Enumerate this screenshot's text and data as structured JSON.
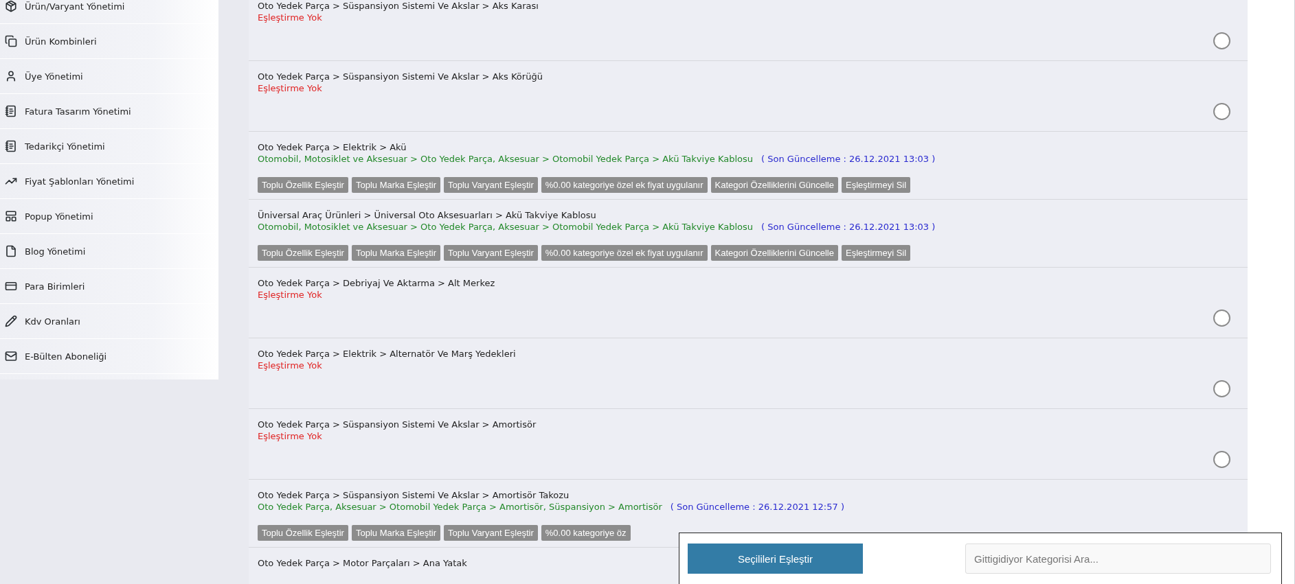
{
  "sidebar": {
    "items": [
      {
        "label": "Ürün/Varyant Yönetimi"
      },
      {
        "label": "Ürün Kombinleri"
      },
      {
        "label": "Üye Yönetimi"
      },
      {
        "label": "Fatura Tasarım Yönetimi"
      },
      {
        "label": "Tedarikçi Yönetimi"
      },
      {
        "label": "Fiyat Şablonları Yönetimi"
      },
      {
        "label": "Popup Yönetimi"
      },
      {
        "label": "Blog Yönetimi"
      },
      {
        "label": "Para Birimleri"
      },
      {
        "label": "Kdv Oranları"
      },
      {
        "label": "E-Bülten Aboneliği"
      }
    ]
  },
  "categories": [
    {
      "kind": "unmapped",
      "path": "Oto Yedek Parça > Süspansiyon Sistemi Ve Akslar > Aks Karası",
      "status": "Eşleştirme Yok",
      "selected": false
    },
    {
      "kind": "unmapped",
      "path": "Oto Yedek Parça > Süspansiyon Sistemi Ve Akslar > Aks Körüğü",
      "status": "Eşleştirme Yok",
      "selected": false
    },
    {
      "kind": "mapped",
      "path": "Oto Yedek Parça > Elektrik > Akü",
      "mapping": "Otomobil, Motosiklet ve Aksesuar > Oto Yedek Parça, Aksesuar > Otomobil Yedek Parça > Akü Takviye Kablosu",
      "updated": "( Son Güncelleme : 26.12.2021 13:03 )",
      "actions": [
        "Toplu Özellik Eşleştir",
        "Toplu Marka Eşleştir",
        "Toplu Varyant Eşleştir",
        "%0.00 kategoriye özel ek fiyat uygulanır",
        "Kategori Özelliklerini Güncelle",
        "Eşleştirmeyi Sil"
      ]
    },
    {
      "kind": "mapped",
      "path": "Üniversal Araç Ürünleri > Üniversal Oto Aksesuarları > Akü Takviye Kablosu",
      "mapping": "Otomobil, Motosiklet ve Aksesuar > Oto Yedek Parça, Aksesuar > Otomobil Yedek Parça > Akü Takviye Kablosu",
      "updated": "( Son Güncelleme : 26.12.2021 13:03 )",
      "actions": [
        "Toplu Özellik Eşleştir",
        "Toplu Marka Eşleştir",
        "Toplu Varyant Eşleştir",
        "%0.00 kategoriye özel ek fiyat uygulanır",
        "Kategori Özelliklerini Güncelle",
        "Eşleştirmeyi Sil"
      ]
    },
    {
      "kind": "unmapped",
      "path": "Oto Yedek Parça > Debriyaj Ve Aktarma > Alt Merkez",
      "status": "Eşleştirme Yok",
      "selected": false
    },
    {
      "kind": "unmapped",
      "path": "Oto Yedek Parça > Elektrik > Alternatör Ve Marş Yedekleri",
      "status": "Eşleştirme Yok",
      "selected": false
    },
    {
      "kind": "unmapped",
      "path": "Oto Yedek Parça > Süspansiyon Sistemi Ve Akslar > Amortisör",
      "status": "Eşleştirme Yok",
      "selected": false
    },
    {
      "kind": "mapped",
      "path": "Oto Yedek Parça > Süspansiyon Sistemi Ve Akslar > Amortisör Takozu",
      "mapping": "Oto Yedek Parça, Aksesuar > Otomobil Yedek Parça > Amortisör, Süspansiyon > Amortisör",
      "updated": "( Son Güncelleme : 26.12.2021 12:57 )",
      "actions": [
        "Toplu Özellik Eşleştir",
        "Toplu Marka Eşleştir",
        "Toplu Varyant Eşleştir",
        "%0.00 kategoriye öz"
      ]
    },
    {
      "kind": "unmapped",
      "path": "Oto Yedek Parça > Motor Parçaları > Ana Yatak"
    }
  ],
  "action_bar": {
    "button": "Seçilileri Eşleştir",
    "search_placeholder": "Gittigidiyor Kategorisi Ara..."
  }
}
